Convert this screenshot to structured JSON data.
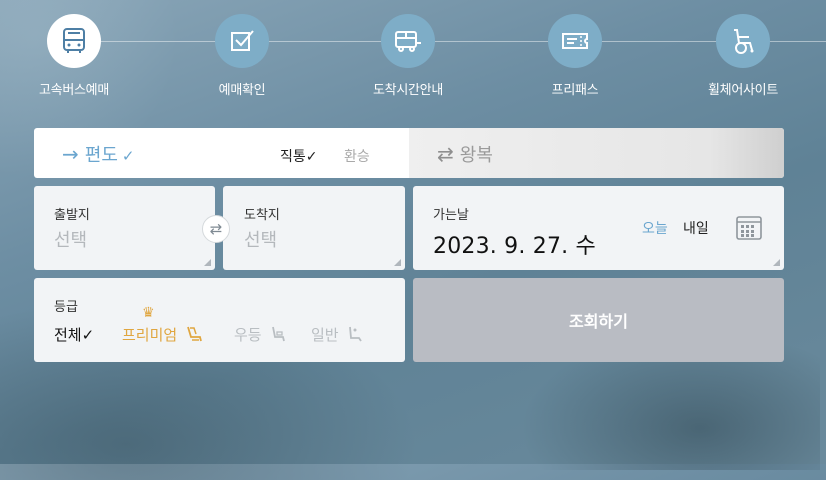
{
  "nav": [
    {
      "label": "고속버스예매",
      "icon": "bus-icon",
      "active": true
    },
    {
      "label": "예매확인",
      "icon": "checkbox-icon",
      "active": false
    },
    {
      "label": "도착시간안내",
      "icon": "bus-arrival-icon",
      "active": false
    },
    {
      "label": "프리패스",
      "icon": "ticket-icon",
      "active": false
    },
    {
      "label": "휠체어사이트",
      "icon": "wheelchair-icon",
      "active": false
    }
  ],
  "trip": {
    "oneway_label": "편도",
    "oneway_check": "✓",
    "direct_label": "직통",
    "direct_check": "✓",
    "transfer_label": "환승",
    "roundtrip_label": "왕복"
  },
  "departure": {
    "label": "출발지",
    "placeholder": "선택"
  },
  "arrival": {
    "label": "도착지",
    "placeholder": "선택"
  },
  "date": {
    "label": "가는날",
    "value": "2023. 9. 27. 수",
    "today_label": "오늘",
    "tomorrow_label": "내일"
  },
  "grade": {
    "label": "등급",
    "all_label": "전체",
    "all_check": "✓",
    "premium_label": "프리미엄",
    "excellent_label": "우등",
    "general_label": "일반"
  },
  "search_label": "조회하기",
  "colors": {
    "accent_blue": "#6ba6cf",
    "premium_gold": "#e0a640",
    "search_button": "#b9bcc3",
    "nav_circle": "#7eadc7"
  }
}
